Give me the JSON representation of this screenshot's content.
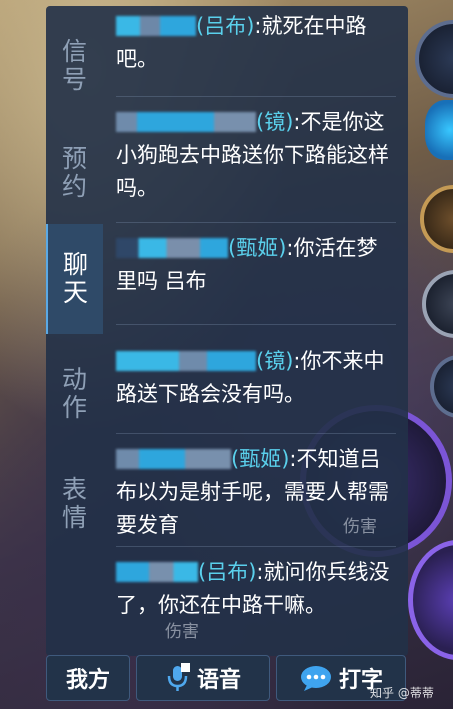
{
  "side_tabs": [
    {
      "line1": "信",
      "line2": "号"
    },
    {
      "line1": "预",
      "line2": "约"
    },
    {
      "line1": "聊",
      "line2": "天"
    },
    {
      "line1": "动",
      "line2": "作"
    },
    {
      "line1": "表",
      "line2": "情"
    }
  ],
  "active_tab": "聊天",
  "messages": [
    {
      "sender": "(吕布)",
      "text": ":就死在中路吧。"
    },
    {
      "sender": "(镜)",
      "text": ":不是你这小狗跑去中路送你下路能这样吗。"
    },
    {
      "sender": "(甄姬)",
      "text": ":你活在梦里吗 吕布"
    },
    {
      "sender": "(镜)",
      "text": ":你不来中路送下路会没有吗。"
    },
    {
      "sender": "(甄姬)",
      "text": ":不知道吕布以为是射手呢，需要人帮需要发育"
    },
    {
      "sender": "(吕布)",
      "text": ":就问你兵线没了，你还在中路干嘛。"
    }
  ],
  "bottom_bar": {
    "team_label": "我方",
    "voice_label": "语音",
    "type_label": "打字"
  },
  "background_labels": {
    "damage_1": "伤害",
    "damage_2": "伤害"
  },
  "watermark": "知乎 @蒂蒂",
  "colors": {
    "panel": "#223148",
    "sender_name": "#5ad0ec",
    "skill_ring": "#7b55d6"
  }
}
